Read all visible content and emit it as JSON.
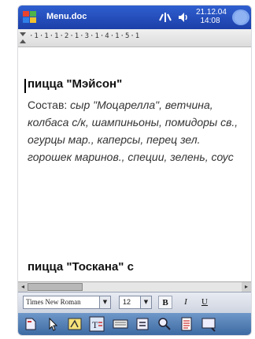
{
  "titlebar": {
    "app_title": "Menu.doc",
    "clock_date": "21.12.04",
    "clock_time": "14:08"
  },
  "ruler": {
    "scale_text": "·1·1·1·2·1·3·1·4·1·5·1"
  },
  "document": {
    "heading1": "пицца \"Мэйсон\"",
    "composition_label": "Состав:",
    "composition_value": "сыр \"Моцарелла\", ветчина, колбаса с/к, шампиньоны, помидоры св., огурцы мар., каперсы, перец зел. горошек маринов., специи, зелень, соус",
    "heading2": "пицца \"Тоскана\" с"
  },
  "format_toolbar": {
    "font_name": "Times New Roman",
    "font_size": "12",
    "bold_label": "B",
    "italic_label": "I",
    "underline_label": "U"
  },
  "tools_toolbar": {
    "icons": [
      "new-icon",
      "pointer-icon",
      "highlight-icon",
      "text-format-icon",
      "keyboard-icon",
      "list-icon",
      "zoom-icon",
      "outline-icon",
      "menu-icon"
    ]
  },
  "colors": {
    "titlebar": "#1c3fa8",
    "toolbar_bottom": "#3d6aa3",
    "text": "#333333"
  }
}
